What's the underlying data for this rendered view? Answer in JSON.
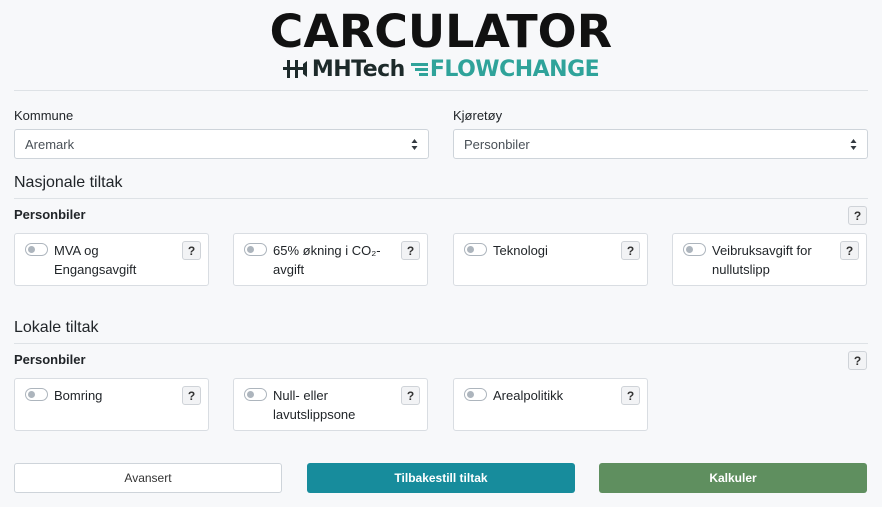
{
  "logo": {
    "title": "CARCULATOR",
    "partner1": "MHTech",
    "partner2": "FLOWCHANGE"
  },
  "fields": {
    "kommune": {
      "label": "Kommune",
      "value": "Aremark"
    },
    "kjoretoy": {
      "label": "Kjøretøy",
      "value": "Personbiler"
    }
  },
  "nasjonale": {
    "title": "Nasjonale tiltak",
    "subtitle": "Personbiler",
    "help": "?",
    "items": [
      {
        "label": "MVA og Engangsavgift",
        "help": "?",
        "enabled": false
      },
      {
        "label": "65% økning i CO₂-avgift",
        "help": "?",
        "enabled": false
      },
      {
        "label": "Teknologi",
        "help": "?",
        "enabled": false
      },
      {
        "label": "Veibruksavgift for nullutslipp",
        "help": "?",
        "enabled": false
      }
    ]
  },
  "lokale": {
    "title": "Lokale tiltak",
    "subtitle": "Personbiler",
    "help": "?",
    "items": [
      {
        "label": "Bomring",
        "help": "?",
        "enabled": false
      },
      {
        "label": "Null- eller lavutslippsone",
        "help": "?",
        "enabled": false
      },
      {
        "label": "Arealpolitikk",
        "help": "?",
        "enabled": false
      }
    ]
  },
  "buttons": {
    "avansert": "Avansert",
    "tilbakestill": "Tilbakestill tiltak",
    "kalkuler": "Kalkuler"
  },
  "colors": {
    "teal": "#178c9c",
    "green": "#5f8f5f",
    "brand_flowchange": "#2fa39a"
  }
}
